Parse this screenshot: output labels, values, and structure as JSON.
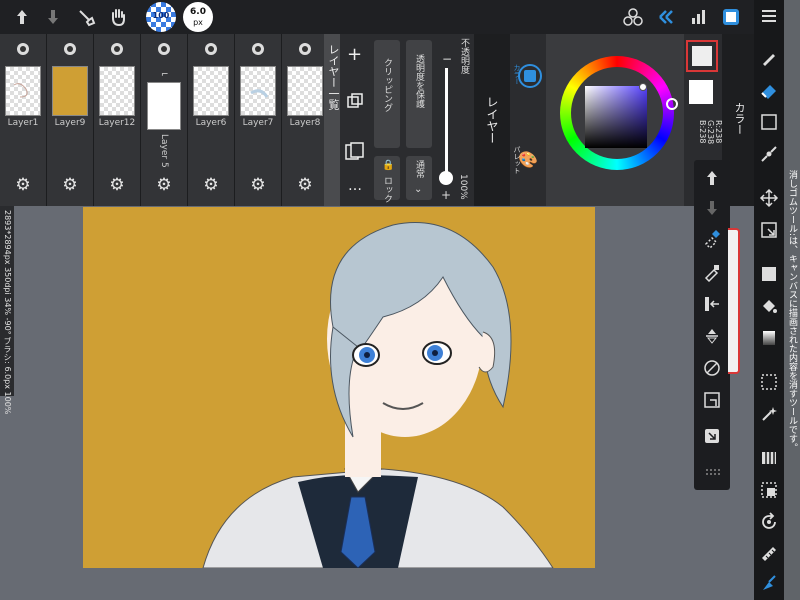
{
  "topbar": {
    "brush_size_label": "6.0",
    "brush_size_unit": "px",
    "opacity_badge": "100",
    "tools_left": [
      "undo-icon",
      "redo-icon",
      "eyedropper-icon",
      "hand-icon"
    ],
    "tools_right": [
      "material-icon",
      "layer-icon",
      "chart-icon",
      "canvas-icon"
    ],
    "menu_icon": "menu-icon"
  },
  "layers_panel": {
    "title": "レイヤー一覧",
    "layers": [
      {
        "name": "Layer1"
      },
      {
        "name": "Layer9"
      },
      {
        "name": "Layer12"
      },
      {
        "name": "Layer 5"
      },
      {
        "name": "Layer6"
      },
      {
        "name": "Layer7"
      },
      {
        "name": "Layer8"
      }
    ],
    "actions": [
      "+",
      "コピー",
      "…"
    ]
  },
  "layer_props": {
    "clipping_label": "クリッピング",
    "protect_alpha_label": "透明度を保護",
    "lock_label": "ロック",
    "blend_mode_label": "通常",
    "opacity_title": "不透明度",
    "opacity_value": "100%",
    "opacity_fraction": 1.0,
    "layer_title": "レイヤー"
  },
  "color_panel": {
    "title": "カラー",
    "tab_color": "カラー",
    "tab_palette": "パレット",
    "rgb_r": "R:238",
    "rgb_g": "G:238",
    "rgb_b": "B:238",
    "fg_color": "#eeeeee",
    "bg_color": "#ffffff"
  },
  "status": {
    "text": "2893*2894px 350dpi 34% -90° ブラシ: 6.0px 100%"
  },
  "hint": {
    "text": "消しゴムツール:は、キャンバスに描画された内容を消すツールです。"
  },
  "colors": {
    "canvas_bg": "#cf9f34",
    "app_bg": "#676b73",
    "accent_blue": "#2f8fde"
  }
}
